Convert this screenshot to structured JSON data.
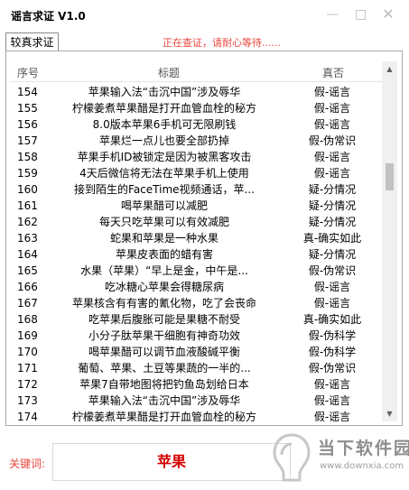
{
  "window": {
    "title": "谣言求证 V1.0",
    "min_icon": "minimize-icon",
    "max_icon": "maximize-icon",
    "close_icon": "close-icon"
  },
  "tab": {
    "label": "较真求证"
  },
  "status": {
    "text": "正在查证，请耐心等待......"
  },
  "table": {
    "headers": {
      "num": "序号",
      "title": "标题",
      "verdict": "真否"
    },
    "rows": [
      {
        "num": "154",
        "title": "苹果输入法“击沉中国”涉及辱华",
        "verdict": "假-谣言"
      },
      {
        "num": "155",
        "title": "柠檬姜煮苹果醋是打开血管血栓的秘方",
        "verdict": "假-谣言"
      },
      {
        "num": "156",
        "title": "8.0版本苹果6手机可无限刷钱",
        "verdict": "假-谣言"
      },
      {
        "num": "157",
        "title": "苹果烂一点儿也要全部扔掉",
        "verdict": "假-伪常识"
      },
      {
        "num": "158",
        "title": "苹果手机ID被锁定是因为被黑客攻击",
        "verdict": "假-谣言"
      },
      {
        "num": "159",
        "title": "4天后微信将无法在苹果手机上使用",
        "verdict": "假-谣言"
      },
      {
        "num": "160",
        "title": "接到陌生的FaceTime视频通话，苹...",
        "verdict": "疑-分情况"
      },
      {
        "num": "161",
        "title": "喝苹果醋可以减肥",
        "verdict": "疑-分情况"
      },
      {
        "num": "162",
        "title": "每天只吃苹果可以有效减肥",
        "verdict": "疑-分情况"
      },
      {
        "num": "163",
        "title": "蛇果和苹果是一种水果",
        "verdict": "真-确实如此"
      },
      {
        "num": "164",
        "title": "苹果皮表面的蜡有害",
        "verdict": "疑-分情况"
      },
      {
        "num": "165",
        "title": "水果（苹果）“早上是金，中午是...",
        "verdict": "假-伪常识"
      },
      {
        "num": "166",
        "title": "吃冰糖心苹果会得糖尿病",
        "verdict": "假-谣言"
      },
      {
        "num": "167",
        "title": "苹果核含有有害的氰化物，吃了会丧命",
        "verdict": "假-谣言"
      },
      {
        "num": "168",
        "title": "吃苹果后腹胀可能是果糖不耐受",
        "verdict": "真-确实如此"
      },
      {
        "num": "169",
        "title": "小分子肽苹果干细胞有神奇功效",
        "verdict": "假-伪科学"
      },
      {
        "num": "170",
        "title": "喝苹果醋可以调节血液酸碱平衡",
        "verdict": "假-伪科学"
      },
      {
        "num": "171",
        "title": "葡萄、苹果、土豆等果蔬的一半的...",
        "verdict": "假-伪常识"
      },
      {
        "num": "172",
        "title": "苹果7自带地图将把钓鱼岛划给日本",
        "verdict": "假-谣言"
      },
      {
        "num": "173",
        "title": "苹果输入法“击沉中国”涉及辱华",
        "verdict": "假-谣言"
      },
      {
        "num": "174",
        "title": "柠檬姜煮苹果醋是打开血管血栓的秘方",
        "verdict": "假-谣言"
      }
    ]
  },
  "keyword": {
    "label": "关键词:",
    "value": "苹果"
  },
  "watermark": {
    "text": "当下软件园",
    "url": "www.downxia.com"
  }
}
